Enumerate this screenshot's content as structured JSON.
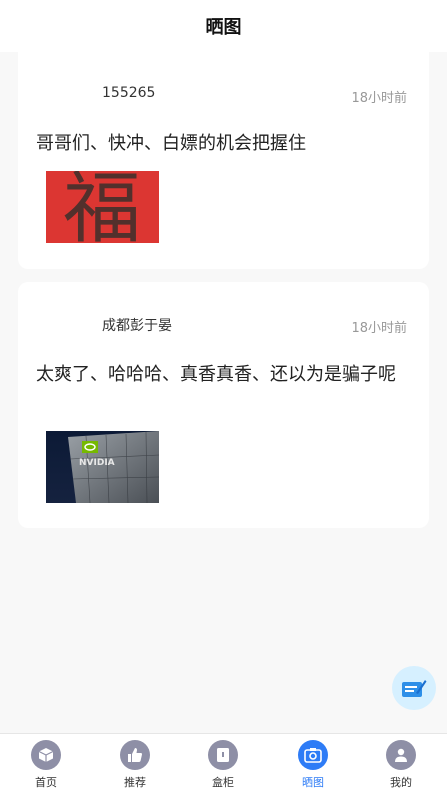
{
  "header": {
    "title": "晒图"
  },
  "posts": [
    {
      "username": "155265",
      "time": "18小时前",
      "content": "哥哥们、快冲、白嫖的机会把握住",
      "image": "fu-character-red-image"
    },
    {
      "username": "成都彭于晏",
      "time": "18小时前",
      "content": "太爽了、哈哈哈、真香真香、还以为是骗子呢",
      "image": "nvidia-building-image",
      "image_text": "NVIDIA"
    }
  ],
  "fab": {
    "icon": "compose-icon",
    "color": "#d6f0ff"
  },
  "tabbar": {
    "items": [
      {
        "label": "首页",
        "icon": "home-cube-icon"
      },
      {
        "label": "推荐",
        "icon": "thumbs-up-icon"
      },
      {
        "label": "盒柜",
        "icon": "cabinet-icon"
      },
      {
        "label": "晒图",
        "icon": "camera-icon",
        "active": true
      },
      {
        "label": "我的",
        "icon": "user-icon"
      }
    ],
    "active_color": "#2e7cf6",
    "inactive_color": "#8e8fa6"
  },
  "fu_char": "福"
}
